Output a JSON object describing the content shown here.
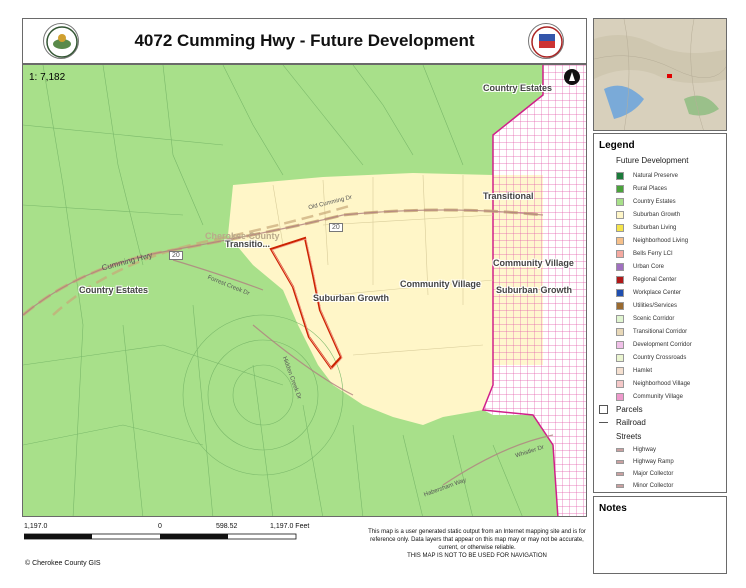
{
  "title": "4072 Cumming Hwy - Future Development",
  "map_labels": {
    "country_estates_ne": "Country Estates",
    "transitional_e": "Transitional",
    "transitional_w": "Transitio...",
    "community_village_e": "Community Village",
    "community_village_c": "Community Village",
    "suburban_growth_e": "Suburban Growth",
    "suburban_growth_c": "Suburban Growth",
    "country_estates_w": "Country Estates",
    "cherokee_county": "Cherokee County",
    "route_20_a": "20",
    "route_20_b": "20",
    "old_cumming_dr": "Old Cumming Dr",
    "cumming_hwy": "Cumming Hwy",
    "forrest_creek_dr": "Forrest Creek Dr",
    "hidden_creek": "Hidden Creek Dr",
    "whistle_dr": "Whistler Dr",
    "habersham": "Habersham Way"
  },
  "legend": {
    "title": "Legend",
    "future_dev_heading": "Future Development",
    "items": [
      {
        "label": "Natural Preserve",
        "color": "#1b7a3a"
      },
      {
        "label": "Rural Places",
        "color": "#4aa33a"
      },
      {
        "label": "Country Estates",
        "color": "#a8e08a"
      },
      {
        "label": "Suburban Growth",
        "color": "#fff6c8"
      },
      {
        "label": "Suburban Living",
        "color": "#f5e44a"
      },
      {
        "label": "Neighborhood Living",
        "color": "#f6c08a"
      },
      {
        "label": "Bells Ferry LCI",
        "color": "#f5a9a0"
      },
      {
        "label": "Urban Core",
        "color": "#a070c0"
      },
      {
        "label": "Regional Center",
        "color": "#b01818"
      },
      {
        "label": "Workplace Center",
        "color": "#1f4fb0"
      },
      {
        "label": "Utilities/Services",
        "color": "#9a6a30"
      },
      {
        "label": "Scenic Corridor",
        "color": "#e0f5d0"
      },
      {
        "label": "Transitional Corridor",
        "color": "#e8d8b8"
      },
      {
        "label": "Development Corridor",
        "color": "#f0c0e8"
      },
      {
        "label": "Country Crossroads",
        "color": "#eaf5d0"
      },
      {
        "label": "Hamlet",
        "color": "#f5e0d0"
      },
      {
        "label": "Neighborhood Village",
        "color": "#f5c8c8"
      },
      {
        "label": "Community Village",
        "color": "#ee99cc"
      }
    ],
    "parcels": "Parcels",
    "railroad": "Railroad",
    "streets_heading": "Streets",
    "streets": [
      "Highway",
      "Highway Ramp",
      "Major Collector",
      "Minor Collector"
    ]
  },
  "notes": "Notes",
  "scale": {
    "ratio": "1: 7,182",
    "left": "1,197.0",
    "zero": "0",
    "mid": "598.52",
    "right": "1,197.0 Feet"
  },
  "disclaimer": {
    "line1": "This map is a user generated static output from an Internet mapping site and is for reference only. Data layers that appear on this map may or may not be accurate, current, or otherwise reliable.",
    "line2": "THIS MAP IS NOT TO BE USED FOR NAVIGATION"
  },
  "copyright": "© Cherokee County GIS",
  "colors": {
    "country_estates": "#a8e08a",
    "suburban_growth": "#fff6c8",
    "community_village": "#e0339a",
    "subject_parcel": "#cc2200"
  }
}
